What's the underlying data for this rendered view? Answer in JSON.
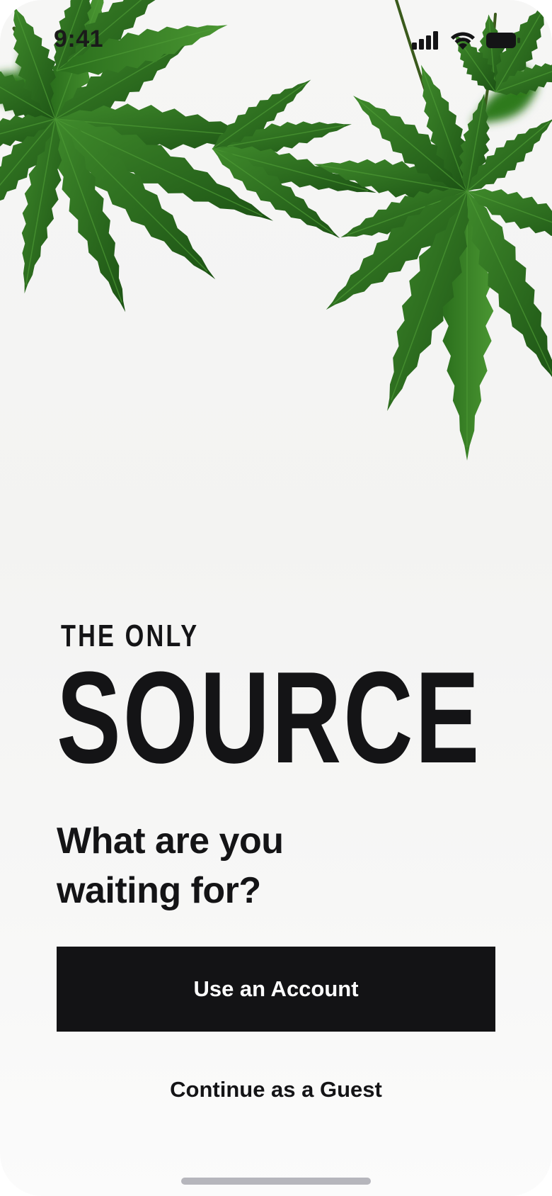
{
  "status_bar": {
    "time": "9:41",
    "icons": [
      "cellular-signal-icon",
      "wifi-icon",
      "battery-icon"
    ]
  },
  "hero": {
    "image": "cannabis-leaves-illustration"
  },
  "headline": {
    "eyebrow": "THE ONLY",
    "brand": "SOURCE"
  },
  "tagline": {
    "line1": "What are you",
    "line2": "waiting for?"
  },
  "actions": {
    "primary_label": "Use an Account",
    "secondary_label": "Continue as a Guest"
  },
  "colors": {
    "ink": "#141416",
    "button_bg": "#131315",
    "button_text": "#ffffff",
    "leaf_dark": "#1f5a16",
    "leaf_mid": "#2f7a1f",
    "leaf_light": "#4d9a35",
    "background": "#f4f4f3"
  }
}
